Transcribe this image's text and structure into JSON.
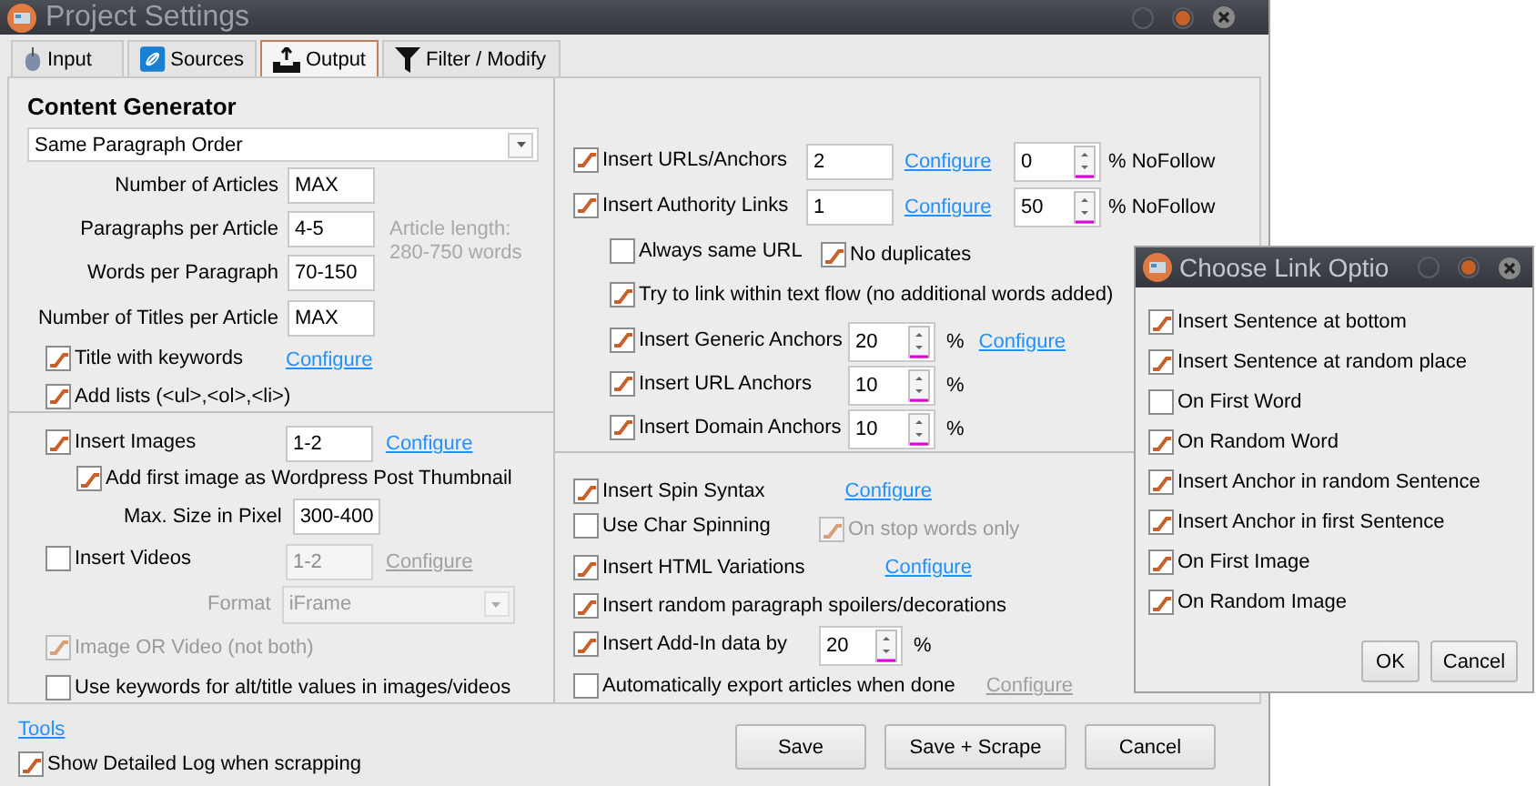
{
  "window": {
    "title": "Project Settings"
  },
  "tabs": [
    {
      "label": "Input",
      "selected": false
    },
    {
      "label": "Sources",
      "selected": false
    },
    {
      "label": "Output",
      "selected": true
    },
    {
      "label": "Filter / Modify",
      "selected": false
    }
  ],
  "content_generator": {
    "heading": "Content Generator",
    "mode": "Same Paragraph Order"
  },
  "article_fields": [
    {
      "label": "Number of Articles",
      "value": "MAX"
    },
    {
      "label": "Paragraphs per Article",
      "value": "4-5"
    },
    {
      "label": "Words per Paragraph",
      "value": "70-150"
    },
    {
      "label": "Number of Titles per Article",
      "value": "MAX"
    }
  ],
  "length_note": "Article length: 280-750 words",
  "title_options": [
    {
      "label": "Title with keywords",
      "checked": true,
      "link": {
        "text": "Configure",
        "disabled": false
      }
    },
    {
      "label": "Add lists (<ul>,<ol>,<li>)",
      "checked": true
    }
  ],
  "media": {
    "images": {
      "label": "Insert Images",
      "checked": true,
      "value": "1-2",
      "disabled": false,
      "link": {
        "text": "Configure",
        "disabled": false
      }
    },
    "thumbnail": {
      "label": "Add first image as Wordpress Post Thumbnail",
      "checked": true
    },
    "max_size": {
      "label": "Max. Size in Pixel",
      "value": "300-400"
    },
    "videos": {
      "label": "Insert Videos",
      "checked": false,
      "value": "1-2",
      "disabled": true,
      "link": {
        "text": "Configure",
        "disabled": true
      }
    },
    "format": {
      "label": "Format",
      "value": "iFrame",
      "disabled": true
    },
    "image_or_video": {
      "label": "Image OR Video (not both)",
      "checked": true,
      "disabled": true
    },
    "keywords": {
      "label": "Use keywords for alt/title values in images/videos",
      "checked": false
    }
  },
  "tools_link": "Tools",
  "detailed_log": {
    "label": "Show Detailed Log when scrapping",
    "checked": true
  },
  "link_rows": [
    {
      "label": "Insert URLs/Anchors",
      "checked": true,
      "value": "2",
      "link": {
        "text": "Configure",
        "disabled": false
      },
      "nofollow": "0",
      "nofollow_label": "% NoFollow"
    },
    {
      "label": "Insert Authority Links",
      "checked": true,
      "value": "1",
      "link": {
        "text": "Configure",
        "disabled": false
      },
      "nofollow": "50",
      "nofollow_label": "% NoFollow"
    }
  ],
  "link_flags": [
    {
      "label": "Always same URL",
      "checked": false
    },
    {
      "label": "No duplicates",
      "checked": true
    }
  ],
  "text_flow": {
    "label": "Try to link within text flow (no additional words added)",
    "checked": true
  },
  "anchor_rows": [
    {
      "label": "Insert Generic Anchors",
      "checked": true,
      "value": "20",
      "unit": "%",
      "link": {
        "text": "Configure",
        "disabled": false
      }
    },
    {
      "label": "Insert URL Anchors",
      "checked": true,
      "value": "10",
      "unit": "%"
    },
    {
      "label": "Insert Domain Anchors",
      "checked": true,
      "value": "10",
      "unit": "%"
    }
  ],
  "spin_options": [
    {
      "kind": "plain",
      "label": "Insert Spin Syntax",
      "checked": true,
      "link": {
        "text": "Configure",
        "disabled": false
      }
    },
    {
      "kind": "sub",
      "label": "Use Char Spinning",
      "checked": false,
      "sub": {
        "label": "On stop words only",
        "checked": true,
        "disabled": true
      }
    },
    {
      "kind": "plain",
      "label": "Insert HTML Variations",
      "checked": true,
      "link": {
        "text": "Configure",
        "disabled": false
      }
    },
    {
      "kind": "plain",
      "label": "Insert random paragraph spoilers/decorations",
      "checked": true
    },
    {
      "kind": "spin",
      "label": "Insert Add-In data by",
      "checked": true,
      "value": "20",
      "unit": "%"
    },
    {
      "kind": "plain",
      "label": "Automatically export articles when done",
      "checked": false,
      "link": {
        "text": "Configure",
        "disabled": true
      }
    }
  ],
  "buttons": [
    "Save",
    "Save + Scrape",
    "Cancel"
  ],
  "dialog": {
    "title": "Choose Link Optio",
    "options": [
      {
        "label": "Insert Sentence at bottom",
        "checked": true
      },
      {
        "label": "Insert Sentence at random place",
        "checked": true
      },
      {
        "label": "On First Word",
        "checked": false
      },
      {
        "label": "On Random Word",
        "checked": true
      },
      {
        "label": "Insert Anchor in random Sentence",
        "checked": true
      },
      {
        "label": "Insert Anchor in first Sentence",
        "checked": true
      },
      {
        "label": "On First Image",
        "checked": true
      },
      {
        "label": "On Random Image",
        "checked": true
      }
    ],
    "buttons": [
      "OK",
      "Cancel"
    ]
  }
}
